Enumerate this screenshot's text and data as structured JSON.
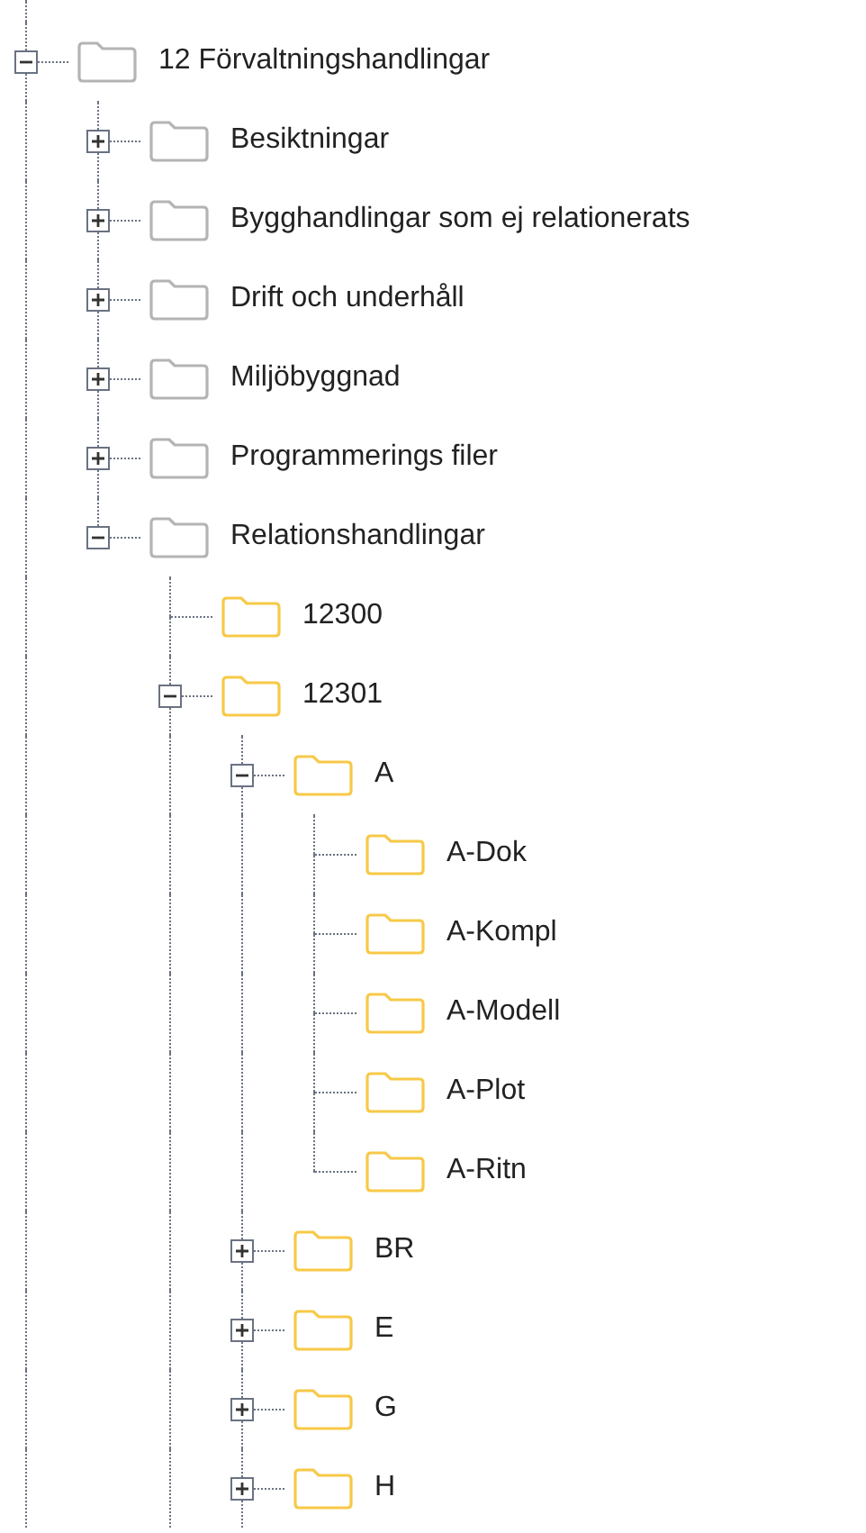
{
  "tree": [
    {
      "label": "12 Förvaltningshandlingar",
      "kind": "branch",
      "expanded": true,
      "last": false,
      "color": "#b4b4b4",
      "children": [
        {
          "label": "Besiktningar",
          "kind": "branch",
          "expanded": false,
          "last": false,
          "color": "#b4b4b4"
        },
        {
          "label": "Bygghandlingar som ej relationerats",
          "kind": "branch",
          "expanded": false,
          "last": false,
          "color": "#b4b4b4"
        },
        {
          "label": "Drift och underhåll",
          "kind": "branch",
          "expanded": false,
          "last": false,
          "color": "#b4b4b4"
        },
        {
          "label": "Miljöbyggnad",
          "kind": "branch",
          "expanded": false,
          "last": false,
          "color": "#b4b4b4"
        },
        {
          "label": "Programmerings filer",
          "kind": "branch",
          "expanded": false,
          "last": false,
          "color": "#b4b4b4"
        },
        {
          "label": "Relationshandlingar",
          "kind": "branch",
          "expanded": true,
          "last": true,
          "color": "#b4b4b4",
          "children": [
            {
              "label": "12300",
              "kind": "leaf",
              "last": false,
              "color": "#f7c948"
            },
            {
              "label": "12301",
              "kind": "branch",
              "expanded": true,
              "last": false,
              "color": "#f7c948",
              "children": [
                {
                  "label": "A",
                  "kind": "branch",
                  "expanded": true,
                  "last": false,
                  "color": "#f7c948",
                  "children": [
                    {
                      "label": "A-Dok",
                      "kind": "leaf",
                      "last": false,
                      "color": "#f7c948"
                    },
                    {
                      "label": "A-Kompl",
                      "kind": "leaf",
                      "last": false,
                      "color": "#f7c948"
                    },
                    {
                      "label": "A-Modell",
                      "kind": "leaf",
                      "last": false,
                      "color": "#f7c948"
                    },
                    {
                      "label": "A-Plot",
                      "kind": "leaf",
                      "last": false,
                      "color": "#f7c948"
                    },
                    {
                      "label": "A-Ritn",
                      "kind": "leaf",
                      "last": true,
                      "color": "#f7c948"
                    }
                  ]
                },
                {
                  "label": "BR",
                  "kind": "branch",
                  "expanded": false,
                  "last": false,
                  "color": "#f7c948"
                },
                {
                  "label": "E",
                  "kind": "branch",
                  "expanded": false,
                  "last": false,
                  "color": "#f7c948"
                },
                {
                  "label": "G",
                  "kind": "branch",
                  "expanded": false,
                  "last": false,
                  "color": "#f7c948"
                },
                {
                  "label": "H",
                  "kind": "branch",
                  "expanded": false,
                  "last": false,
                  "color": "#f7c948"
                }
              ]
            }
          ]
        }
      ]
    }
  ]
}
